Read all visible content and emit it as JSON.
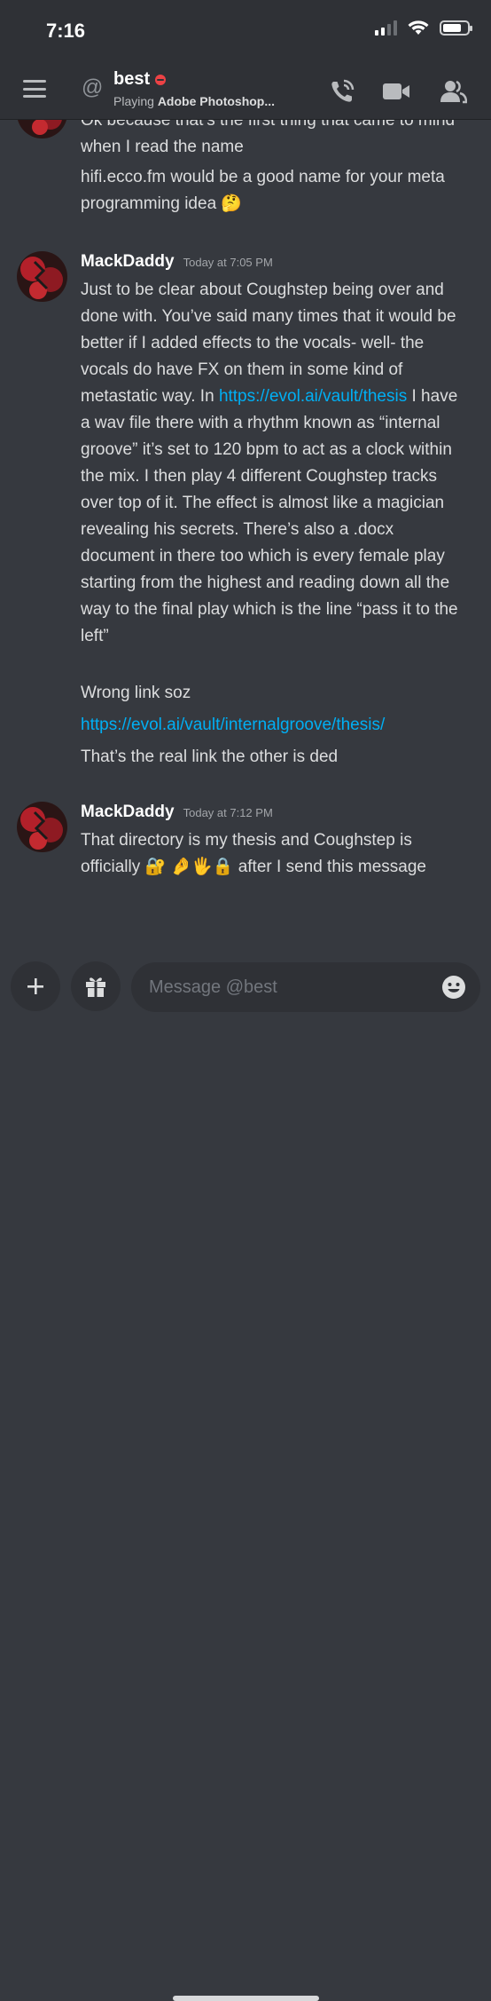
{
  "status_bar": {
    "time": "7:16"
  },
  "header": {
    "name": "best",
    "activity_prefix": "Playing",
    "activity_game": "Adobe Photoshop..."
  },
  "messages": [
    {
      "continuation": true,
      "lines": [
        "Ok because that’s the first thing that came to mind when I read the name",
        "hifi.ecco.fm would be a good name for your meta programming idea"
      ],
      "emoji": "🤔"
    },
    {
      "author": "MackDaddy",
      "timestamp": "Today at 7:05 PM",
      "body_part1": "Just to be clear about Coughstep being over and done with. You’ve said many times that it would be better if I added effects to the vocals- well- the vocals do have FX on them in some kind of metastatic way. In ",
      "body_link": "https://evol.ai/vault/thesis",
      "body_part2": " I have a wav file there with a rhythm known as “internal groove” it’s set to 120 bpm to act as a clock within the mix. I then play 4 different Coughstep tracks over top of it. The effect is almost like a magician revealing his secrets. There’s also a .docx document in there too which is every female play starting from the highest and reading down all the way to the final play which is the line “pass it to the left”",
      "followups": [
        "Wrong link soz"
      ],
      "link2": "https://evol.ai/vault/internalgroove/thesis/",
      "followup_last": "That’s the real link the other is ded"
    },
    {
      "author": "MackDaddy",
      "timestamp": "Today at 7:12 PM",
      "text_before": "That directory is my thesis and Coughstep is officially",
      "emojis": "🔐 🤌🖐🔒",
      "text_after": " after I send this message"
    }
  ],
  "composer": {
    "placeholder": "Message @best"
  },
  "colors": {
    "background": "#36393f",
    "header": "#2f3136",
    "link": "#00aff4",
    "dnd": "#ed4245"
  },
  "icons": [
    "menu-icon",
    "at-icon",
    "dnd-status-icon",
    "phone-call-icon",
    "video-camera-icon",
    "members-icon",
    "plus-icon",
    "gift-icon",
    "emoji-smile-icon"
  ]
}
